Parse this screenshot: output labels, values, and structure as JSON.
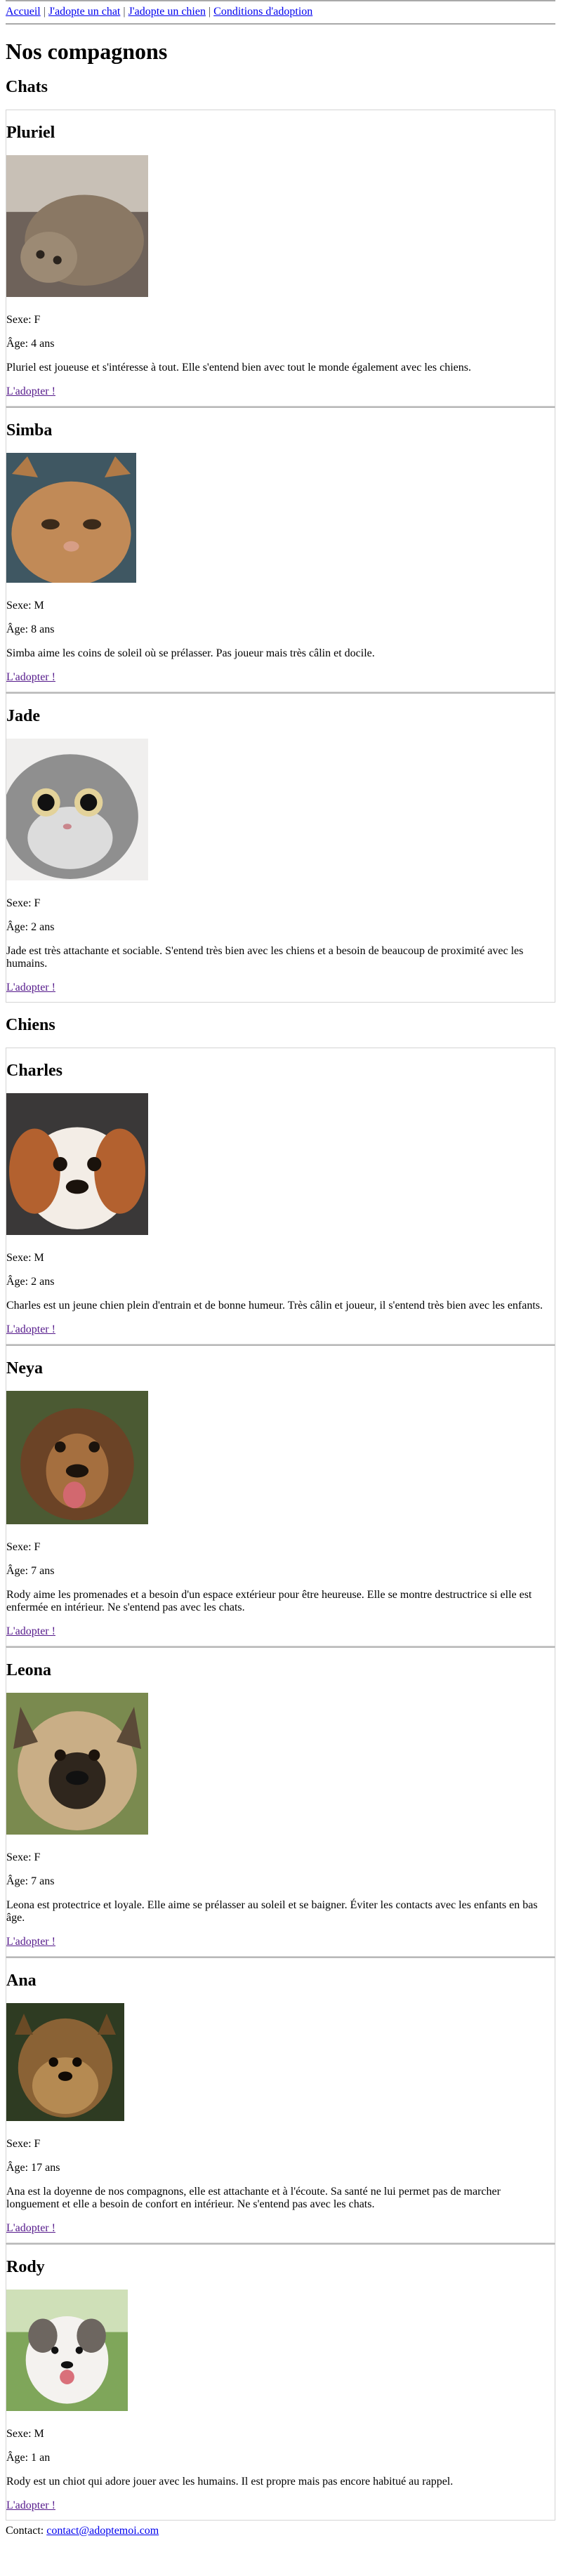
{
  "nav": {
    "items": [
      {
        "label": "Accueil"
      },
      {
        "label": "J'adopte un chat"
      },
      {
        "label": "J'adopte un chien"
      },
      {
        "label": "Conditions d'adoption"
      }
    ],
    "separator": "|"
  },
  "page_title": "Nos compagnons",
  "sections": {
    "cats": {
      "title": "Chats",
      "animals": [
        {
          "name": "Pluriel",
          "sexe": "Sexe: F",
          "age": "Âge: 4 ans",
          "description": "Pluriel est joueuse et s'intéresse à tout. Elle s'entend bien avec tout le monde également avec les chiens.",
          "link": "L'adopter !",
          "photo": "tabby-cat-photo"
        },
        {
          "name": "Simba",
          "sexe": "Sexe: M",
          "age": "Âge: 8 ans",
          "description": "Simba aime les coins de soleil où se prélasser. Pas joueur mais très câlin et docile.",
          "link": "L'adopter !",
          "photo": "ginger-persian-cat-photo"
        },
        {
          "name": "Jade",
          "sexe": "Sexe: F",
          "age": "Âge: 2 ans",
          "description": "Jade est très attachante et sociable. S'entend très bien avec les chiens et a besoin de beaucoup de proximité avec les humains.",
          "link": "L'adopter !",
          "photo": "grey-longhair-cat-photo"
        }
      ]
    },
    "dogs": {
      "title": "Chiens",
      "animals": [
        {
          "name": "Charles",
          "sexe": "Sexe: M",
          "age": "Âge: 2 ans",
          "description": "Charles est un jeune chien plein d'entrain et de bonne humeur. Très câlin et joueur, il s'entend très bien avec les enfants.",
          "link": "L'adopter !",
          "photo": "cavalier-puppy-photo"
        },
        {
          "name": "Neya",
          "sexe": "Sexe: F",
          "age": "Âge: 7 ans",
          "description": "Rody aime les promenades et a besoin d'un espace extérieur pour être heureuse. Elle se montre destructrice si elle est enfermée en intérieur. Ne s'entend pas avec les chats.",
          "link": "L'adopter !",
          "photo": "brown-shepherd-dog-photo"
        },
        {
          "name": "Leona",
          "sexe": "Sexe: F",
          "age": "Âge: 7 ans",
          "description": "Leona est protectrice et loyale. Elle aime se prélasser au soleil et se baigner. Éviter les contacts avec les enfants en bas âge.",
          "link": "L'adopter !",
          "photo": "tan-shepherd-dog-photo"
        },
        {
          "name": "Ana",
          "sexe": "Sexe: F",
          "age": "Âge: 17 ans",
          "description": "Ana est la doyenne de nos compagnons, elle est attachante et à l'écoute. Sa santé ne lui permet pas de marcher longuement et elle a besoin de confort en intérieur. Ne s'entend pas avec les chats.",
          "link": "L'adopter !",
          "photo": "yorkshire-terrier-photo"
        },
        {
          "name": "Rody",
          "sexe": "Sexe: M",
          "age": "Âge: 1 an",
          "description": "Rody est un chiot qui adore jouer avec les humains. Il est propre mais pas encore habitué au rappel.",
          "link": "L'adopter !",
          "photo": "white-puppy-photo"
        }
      ]
    }
  },
  "footer": {
    "contact_label": "Contact:",
    "email": "contact@adoptemoi.com"
  },
  "colors": {
    "link": "#0000ee",
    "visited_link": "#551a8b",
    "card_border": "#d4d4d4",
    "rule": "#a9a9a9"
  }
}
